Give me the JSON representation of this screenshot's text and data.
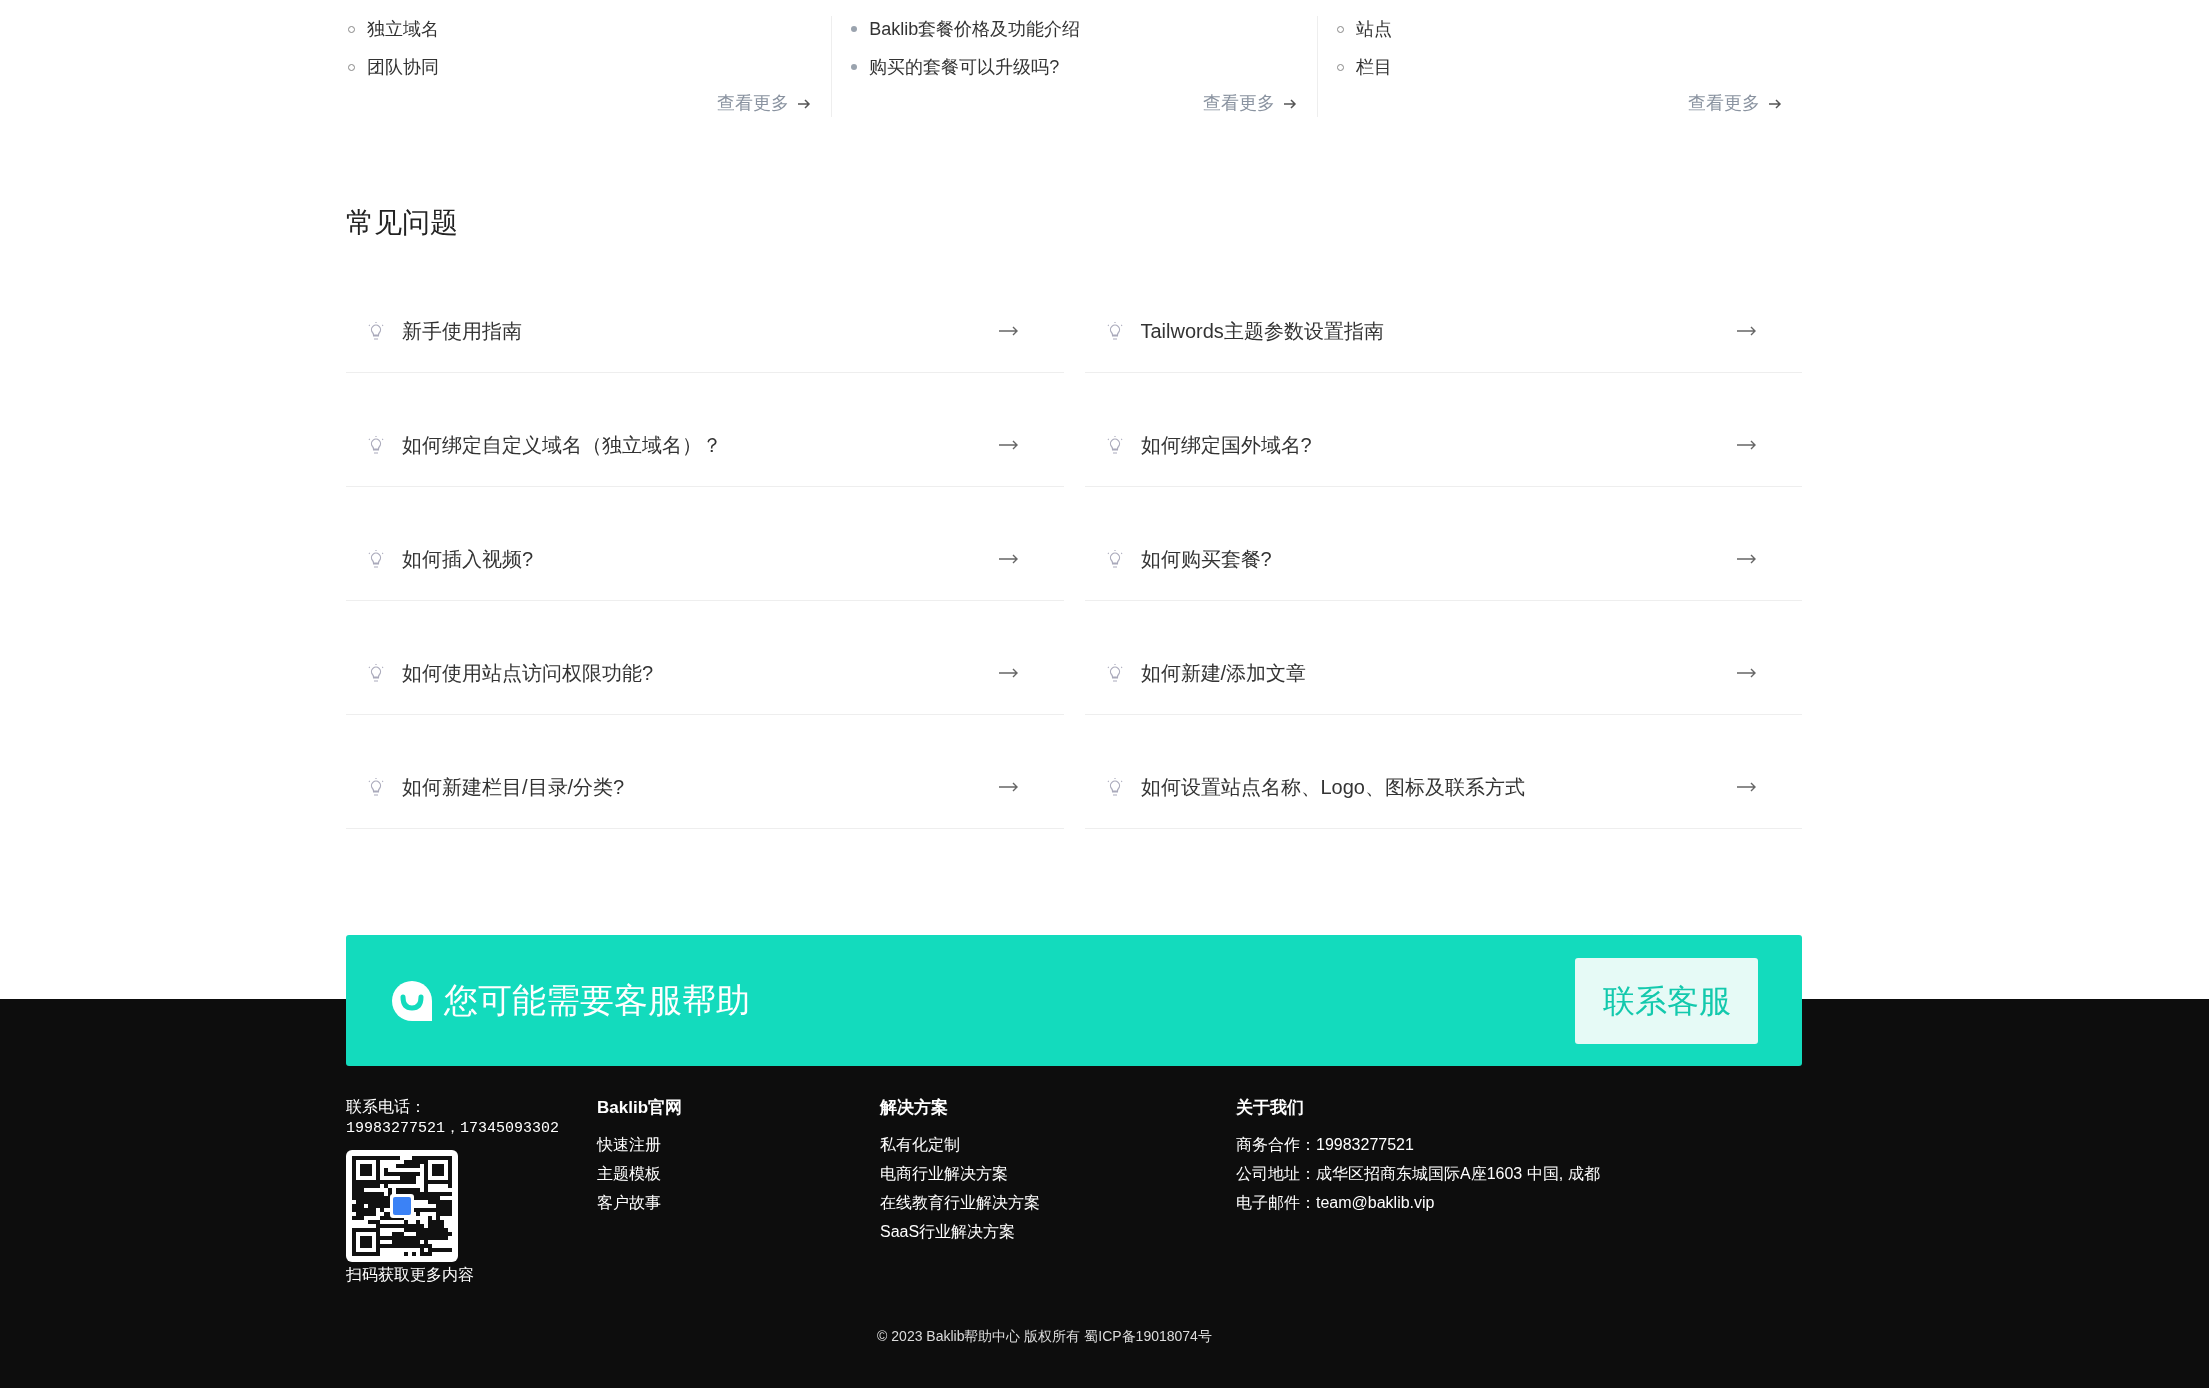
{
  "doc_columns": [
    {
      "items": [
        {
          "text": "独立域名"
        },
        {
          "text": "团队协同"
        }
      ],
      "more": "查看更多"
    },
    {
      "items": [
        {
          "text": "Baklib套餐价格及功能介绍"
        },
        {
          "text": "购买的套餐可以升级吗?"
        }
      ],
      "more": "查看更多"
    },
    {
      "items": [
        {
          "text": "站点"
        },
        {
          "text": "栏目"
        }
      ],
      "more": "查看更多"
    }
  ],
  "faq": {
    "title": "常见问题",
    "items": [
      {
        "text": "新手使用指南"
      },
      {
        "text": "Tailwords主题参数设置指南"
      },
      {
        "text": "如何绑定自定义域名（独立域名）？"
      },
      {
        "text": "如何绑定国外域名?"
      },
      {
        "text": "如何插入视频?"
      },
      {
        "text": "如何购买套餐?"
      },
      {
        "text": "如何使用站点访问权限功能?"
      },
      {
        "text": "如何新建/添加文章"
      },
      {
        "text": "如何新建栏目/目录/分类?"
      },
      {
        "text": "如何设置站点名称、Logo、图标及联系方式"
      }
    ]
  },
  "help_banner": {
    "text": "您可能需要客服帮助",
    "button": "联系客服"
  },
  "footer": {
    "contact": {
      "label": "联系电话：",
      "phones": "19983277521，17345093302",
      "qr_caption": "扫码获取更多内容"
    },
    "columns": [
      {
        "title": "Baklib官网",
        "links": [
          "快速注册",
          "主题模板",
          "客户故事"
        ]
      },
      {
        "title": "解决方案",
        "links": [
          "私有化定制",
          "电商行业解决方案",
          "在线教育行业解决方案",
          "SaaS行业解决方案"
        ]
      },
      {
        "title": "关于我们",
        "links": [
          "商务合作：19983277521",
          "公司地址：成华区招商东城国际A座1603 中国, 成都",
          "电子邮件：team@baklib.vip"
        ]
      }
    ],
    "copyright": "© 2023 Baklib帮助中心 版权所有 蜀ICP备19018074号"
  }
}
